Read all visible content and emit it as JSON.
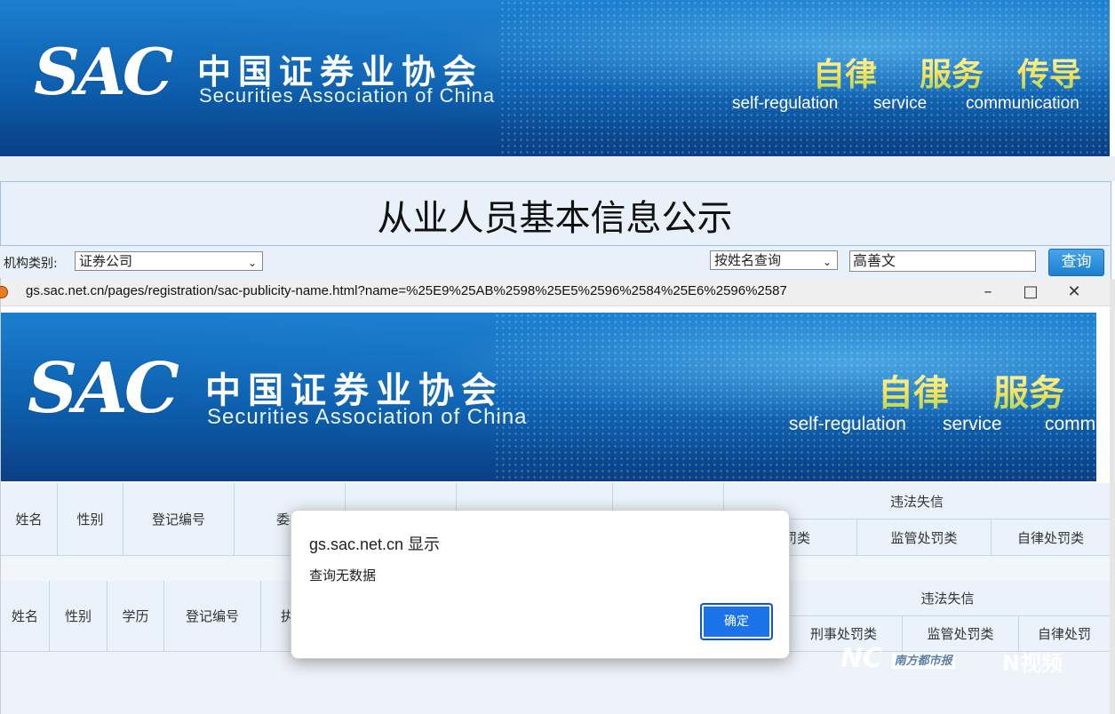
{
  "banner": {
    "logo": "SAC",
    "org_cn": "中国证券业协会",
    "org_en": "Securities Association of China",
    "slogans": [
      {
        "cn": "自律",
        "en": "self-regulation"
      },
      {
        "cn": "服务",
        "en": "service"
      },
      {
        "cn": "传导",
        "en": "communication"
      }
    ]
  },
  "popup_banner": {
    "logo": "SAC",
    "org_cn": "中国证券业协会",
    "org_en": "Securities Association of China",
    "slogans": [
      {
        "cn": "自律",
        "en": "self-regulation"
      },
      {
        "cn": "服务",
        "en": "service"
      },
      {
        "en": "comm"
      }
    ]
  },
  "page": {
    "title": "从业人员基本信息公示",
    "org_type_label": "机构类别:",
    "org_type_value": "证券公司",
    "query_mode": "按姓名查询",
    "name_value": "高善文",
    "search_button": "查询"
  },
  "popup": {
    "url": "gs.sac.net.cn/pages/registration/sac-publicity-name.html?name=%25E9%25AB%2598%25E5%2596%2584%25E6%2596%2587",
    "table1": {
      "headers": [
        "姓名",
        "性别",
        "登记编号",
        "委托"
      ],
      "group_header": "违法失信",
      "sub_headers": [
        "处罚类",
        "监管处罚类",
        "自律处罚类"
      ]
    },
    "table2": {
      "headers": [
        "姓名",
        "性别",
        "学历",
        "登记编号",
        "执"
      ],
      "group_header": "违法失信",
      "sub_headers": [
        "刑事处罚类",
        "监管处罚类",
        "自律处罚"
      ]
    }
  },
  "dialog": {
    "title": "gs.sac.net.cn 显示",
    "message": "查询无数据",
    "ok_button": "确定"
  },
  "watermark": {
    "left": "NC",
    "left_sub": "南方都市报",
    "right": "N视频"
  },
  "colors": {
    "banner_blue": "#0d5fae",
    "button_blue": "#1a73e8",
    "slogan_yellow": "#f6e35a"
  }
}
